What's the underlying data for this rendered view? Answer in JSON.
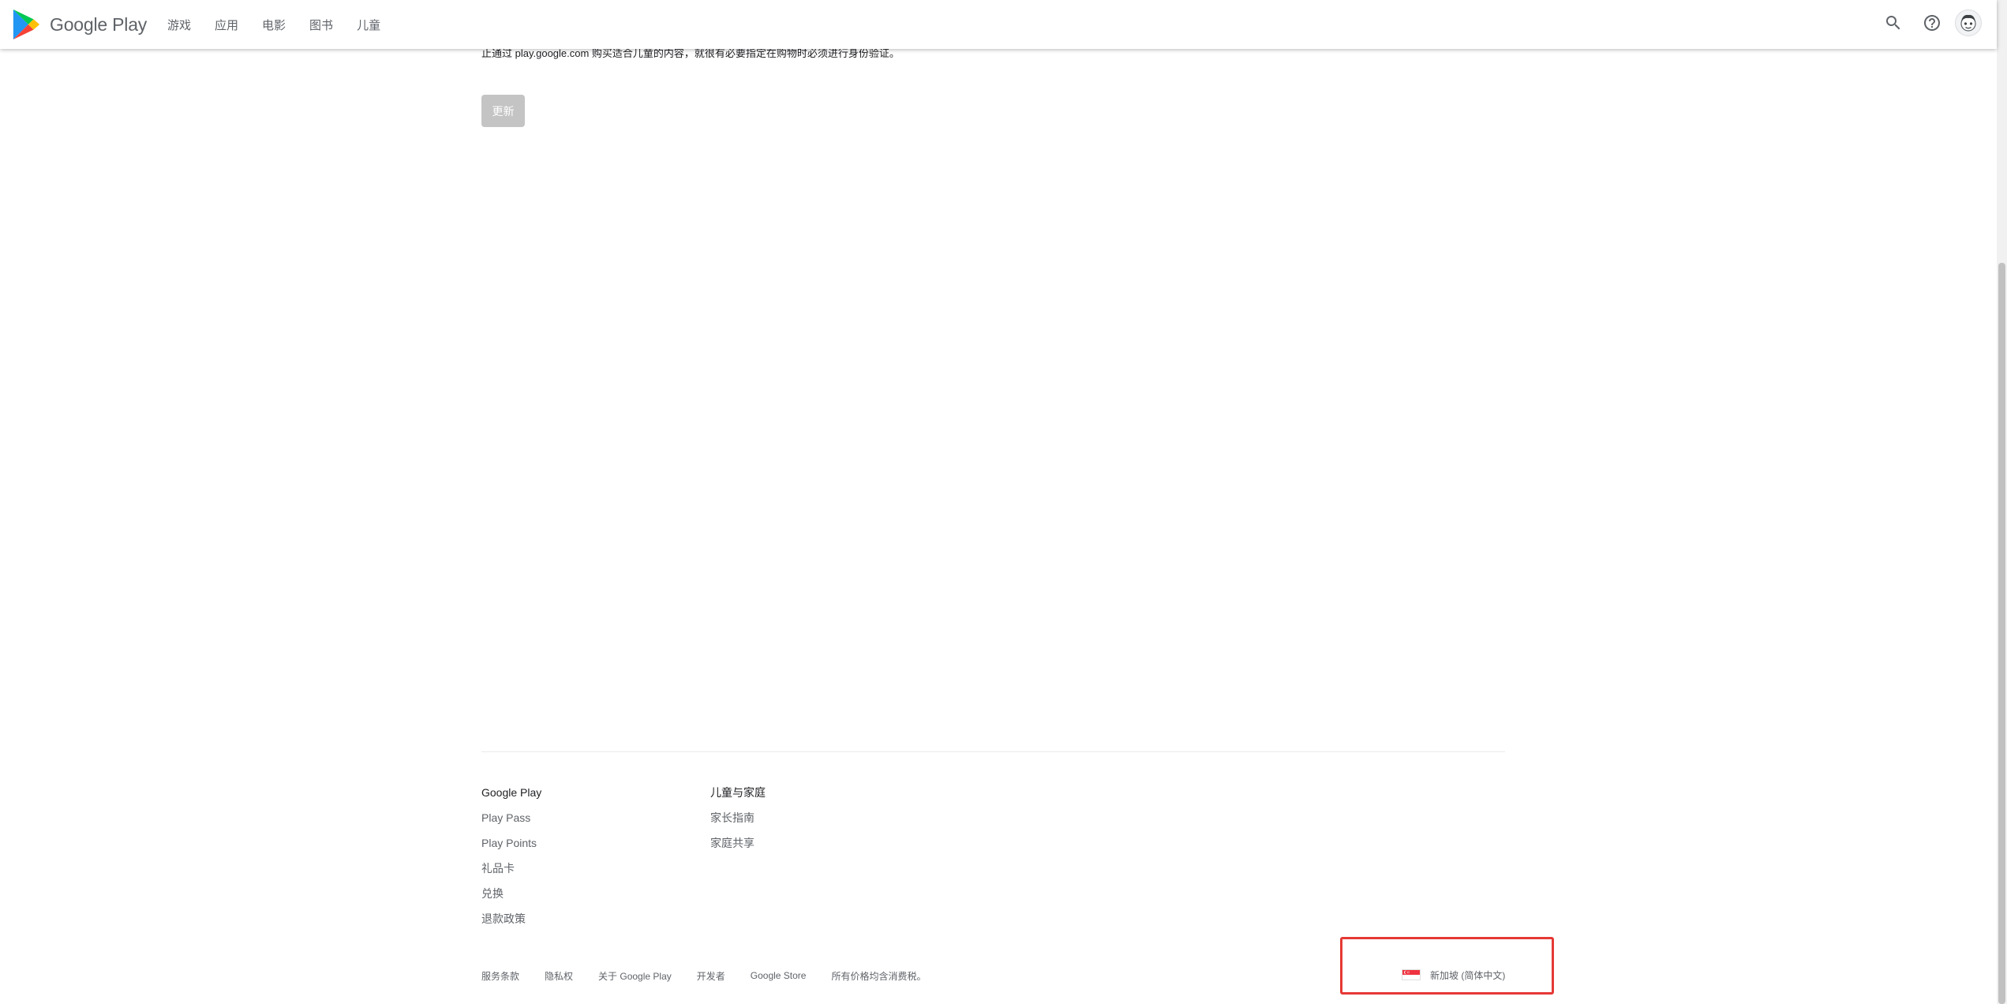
{
  "header": {
    "brand": "Google Play",
    "nav": [
      "游戏",
      "应用",
      "电影",
      "图书",
      "儿童"
    ],
    "icons": [
      "search-icon",
      "help-icon",
      "account-avatar"
    ]
  },
  "main": {
    "notice": "止通过 play.google.com 购买适合儿童的内容，就很有必要指定在购物时必须进行身份验证。",
    "update_button": "更新"
  },
  "footer": {
    "col1": {
      "title": "Google Play",
      "links": [
        "Play Pass",
        "Play Points",
        "礼品卡",
        "兑换",
        "退款政策"
      ]
    },
    "col2": {
      "title": "儿童与家庭",
      "links": [
        "家长指南",
        "家庭共享"
      ]
    },
    "bottom_links": [
      "服务条款",
      "隐私权",
      "关于 Google Play",
      "开发者",
      "Google Store"
    ],
    "tax_note": "所有价格均含消费税。",
    "locale": "新加坡 (简体中文)"
  },
  "colors": {
    "text_secondary": "#5f6368",
    "text_primary": "#202124",
    "button_disabled": "#c4c4c4",
    "highlight_box": "#e53935"
  }
}
